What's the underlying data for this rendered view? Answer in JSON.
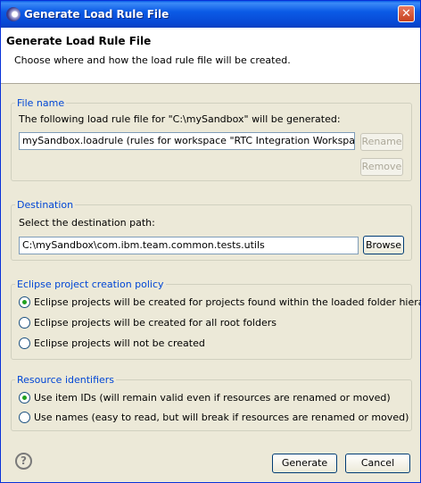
{
  "window": {
    "title": "Generate Load Rule File",
    "close_glyph": "✕"
  },
  "header": {
    "title": "Generate Load Rule File",
    "description": "Choose where and how the load rule file will be created."
  },
  "file_name": {
    "legend": "File name",
    "info": "The following load rule file for \"C:\\mySandbox\" will be generated:",
    "value": "mySandbox.loadrule   (rules for workspace \"RTC Integration Workspace\")",
    "rename_label": "Rename",
    "remove_label": "Remove"
  },
  "destination": {
    "legend": "Destination",
    "prompt": "Select the destination path:",
    "path": "C:\\mySandbox\\com.ibm.team.common.tests.utils",
    "browse_label": "Browse"
  },
  "eclipse_policy": {
    "legend": "Eclipse project creation policy",
    "options": [
      {
        "label": "Eclipse projects will be created for projects found within the loaded folder hierarchy",
        "selected": true
      },
      {
        "label": "Eclipse projects will be created for all root folders",
        "selected": false
      },
      {
        "label": "Eclipse projects will not be created",
        "selected": false
      }
    ]
  },
  "resource_identifiers": {
    "legend": "Resource identifiers",
    "options": [
      {
        "label": "Use item IDs (will remain valid even if resources are renamed or moved)",
        "selected": true
      },
      {
        "label": "Use names (easy to read, but will break if resources are renamed or moved)",
        "selected": false
      }
    ]
  },
  "footer": {
    "help_glyph": "?",
    "generate_label": "Generate",
    "cancel_label": "Cancel"
  }
}
